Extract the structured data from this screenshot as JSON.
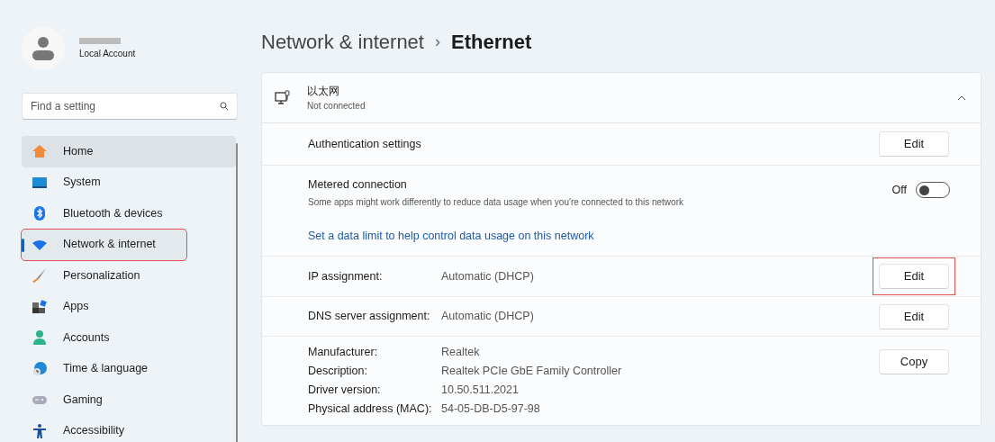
{
  "account": {
    "type": "Local Account"
  },
  "search": {
    "placeholder": "Find a setting"
  },
  "nav": [
    {
      "label": "Home",
      "selected": false,
      "hovered": true,
      "highlighted": false
    },
    {
      "label": "System",
      "selected": false,
      "hovered": false,
      "highlighted": false
    },
    {
      "label": "Bluetooth & devices",
      "selected": false,
      "hovered": false,
      "highlighted": false
    },
    {
      "label": "Network & internet",
      "selected": true,
      "hovered": false,
      "highlighted": true
    },
    {
      "label": "Personalization",
      "selected": false,
      "hovered": false,
      "highlighted": false
    },
    {
      "label": "Apps",
      "selected": false,
      "hovered": false,
      "highlighted": false
    },
    {
      "label": "Accounts",
      "selected": false,
      "hovered": false,
      "highlighted": false
    },
    {
      "label": "Time & language",
      "selected": false,
      "hovered": false,
      "highlighted": false
    },
    {
      "label": "Gaming",
      "selected": false,
      "hovered": false,
      "highlighted": false
    },
    {
      "label": "Accessibility",
      "selected": false,
      "hovered": false,
      "highlighted": false
    }
  ],
  "breadcrumb": {
    "parent": "Network & internet",
    "separator": "›",
    "current": "Ethernet"
  },
  "adapter": {
    "name": "以太网",
    "status": "Not connected",
    "expanded": true
  },
  "rows": [
    {
      "kind": "button",
      "label": "Authentication settings",
      "button": "Edit",
      "highlighted": false
    },
    {
      "kind": "toggle",
      "label": "Metered connection",
      "description": "Some apps might work differently to reduce data usage when you're connected to this network",
      "state_text": "Off",
      "on": false,
      "link": "Set a data limit to help control data usage on this network"
    },
    {
      "kind": "value",
      "label": "IP assignment:",
      "value": "Automatic (DHCP)",
      "button": "Edit",
      "highlighted": true
    },
    {
      "kind": "value",
      "label": "DNS server assignment:",
      "value": "Automatic (DHCP)",
      "button": "Edit",
      "highlighted": false
    },
    {
      "kind": "details",
      "button": "Copy",
      "highlighted": false,
      "items": [
        {
          "label": "Manufacturer:",
          "value": "Realtek"
        },
        {
          "label": "Description:",
          "value": "Realtek PCIe GbE Family Controller"
        },
        {
          "label": "Driver version:",
          "value": "10.50.511.2021"
        },
        {
          "label": "Physical address (MAC):",
          "value": "54-05-DB-D5-97-98"
        }
      ]
    }
  ]
}
